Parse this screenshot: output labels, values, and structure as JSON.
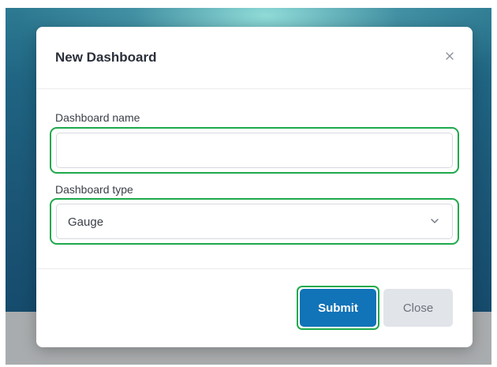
{
  "modal": {
    "title": "New Dashboard",
    "close_icon": "close-icon"
  },
  "form": {
    "name_label": "Dashboard name",
    "name_value": "",
    "name_placeholder": "",
    "type_label": "Dashboard type",
    "type_value": "Gauge",
    "type_icon": "chevron-down-icon"
  },
  "footer": {
    "submit_label": "Submit",
    "close_label": "Close"
  },
  "colors": {
    "primary": "#1173b8",
    "focus_ring": "#1ea94c",
    "secondary_button": "#e1e4e9"
  }
}
